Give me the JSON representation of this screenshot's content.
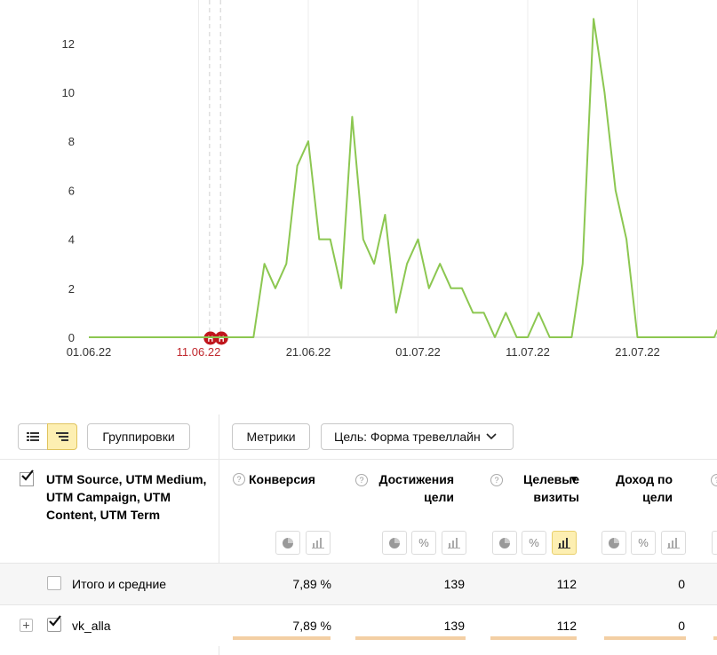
{
  "chart_data": {
    "type": "line",
    "x_ticks": [
      "01.06.22",
      "11.06.22",
      "21.06.22",
      "01.07.22",
      "11.07.22",
      "21.07.22"
    ],
    "holiday_tick": "11.06.22",
    "holiday_markers": [
      "Н",
      "Н"
    ],
    "y_ticks": [
      0,
      2,
      4,
      6,
      8,
      10,
      12
    ],
    "ylim": [
      0,
      13
    ],
    "grid": true,
    "series": [
      {
        "color": "#8cc751",
        "start": "01.06.22",
        "values": [
          0,
          0,
          0,
          0,
          0,
          0,
          0,
          0,
          0,
          0,
          0,
          0,
          0,
          0,
          0,
          0,
          3,
          2,
          3,
          7,
          8,
          4,
          4,
          2,
          9,
          4,
          3,
          5,
          1,
          3,
          4,
          2,
          3,
          2,
          2,
          1,
          1,
          0,
          1,
          0,
          0,
          1,
          0,
          0,
          0,
          3,
          13,
          10,
          6,
          4,
          0,
          0,
          0,
          0,
          0,
          0,
          0,
          0,
          1
        ]
      }
    ]
  },
  "toolbar": {
    "list_icon": "list-view-icon",
    "tree_icon": "tree-view-icon",
    "groupings": "Группировки",
    "metrics": "Метрики",
    "goal_select": "Цель: Форма тревеллайн"
  },
  "table": {
    "dimension_title": "UTM Source, UTM Medium, UTM Campaign, UTM Content, UTM Term",
    "columns": [
      {
        "label": "Конверсия",
        "sorted": false
      },
      {
        "label": "Достижения цели",
        "sorted": false
      },
      {
        "label": "Целевые визиты",
        "sorted": true,
        "sort_arrow": "▼"
      },
      {
        "label": "Доход по цели",
        "sorted": false
      }
    ],
    "icons": {
      "pie": "pie-chart-icon",
      "percent": "%",
      "bars": "bar-chart-icon"
    },
    "total": {
      "label": "Итого и средние",
      "conversion": "7,89 %",
      "goal_reaches": "139",
      "goal_visits": "112",
      "revenue": "0"
    },
    "rows": [
      {
        "expand": "+",
        "label": "vk_alla",
        "conversion": "7,89 %",
        "goal_reaches": "139",
        "goal_visits": "112",
        "revenue": "0"
      }
    ],
    "colors": {
      "accent_yellow": "#fdefb2",
      "share_bar": "#f3cfa4",
      "row_marker": "#8fd15c"
    }
  }
}
